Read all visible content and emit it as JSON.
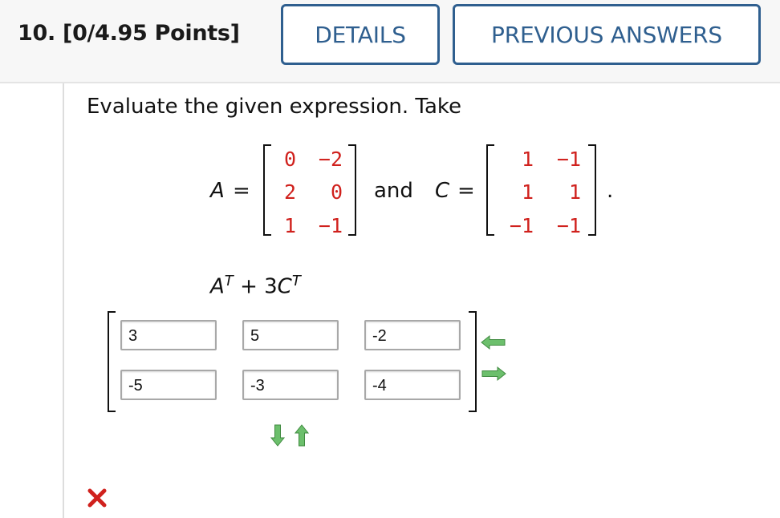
{
  "question": {
    "title": "10.  [0/4.95 Points]",
    "details_label": "DETAILS",
    "previous_answers_label": "PREVIOUS ANSWERS"
  },
  "prompt": "Evaluate the given expression. Take",
  "given": {
    "A_label": "A",
    "C_label": "C",
    "equals": "=",
    "and_text": "and",
    "period": ".",
    "A": [
      [
        "0",
        "−2"
      ],
      [
        "2",
        "0"
      ],
      [
        "1",
        "−1"
      ]
    ],
    "C": [
      [
        "1",
        "−1"
      ],
      [
        "1",
        "1"
      ],
      [
        "−1",
        "−1"
      ]
    ]
  },
  "expression": {
    "a": "A",
    "sup": "T",
    "plus": "+ 3",
    "c": "C"
  },
  "answer": {
    "cells": [
      [
        "3",
        "5",
        "-2"
      ],
      [
        "-5",
        "-3",
        "-4"
      ]
    ]
  },
  "status": {
    "icon": "incorrect-x-icon",
    "color": "#d0211d"
  },
  "colors": {
    "accent": "#2f5f8f",
    "matrix_values": "#d0211d",
    "arrow_green": "#5aa85a"
  }
}
